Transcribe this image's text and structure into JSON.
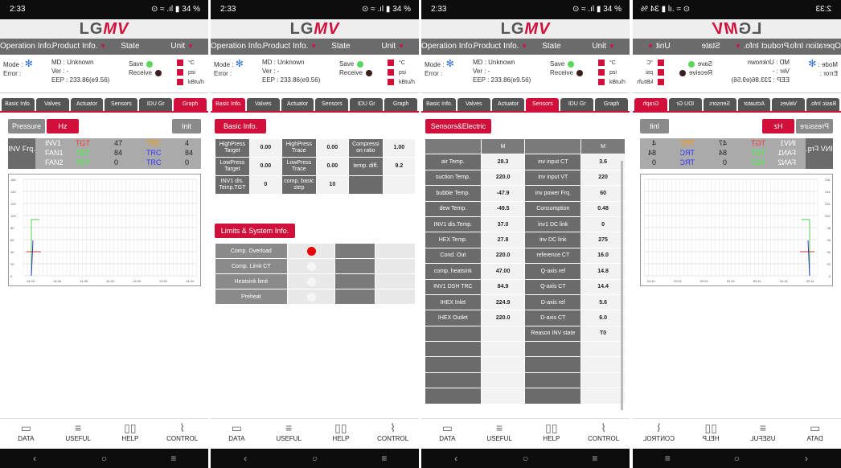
{
  "status": {
    "time": "2:33",
    "battery": "34 %"
  },
  "logo": {
    "lg": "LG",
    "mv": "MV"
  },
  "hdr": {
    "op": "Operation Info.",
    "prod": "Product Info.",
    "state": "State",
    "unit": "Unit"
  },
  "info": {
    "mode": "Mode",
    "colon": ":",
    "error": "Error :",
    "md": "MD : Unknown",
    "ver": "Ver : -",
    "eep": "EEP : 233.86(e9.56)",
    "save": "Save",
    "receive": "Receive",
    "c": "°C",
    "psi": "psi",
    "kbtuh": "kBtu/h"
  },
  "tabs": [
    "Basic Info.",
    "Valves",
    "Actuator",
    "Sensors",
    "IDU Gr",
    "Graph"
  ],
  "p1": {
    "pressure": "Pressure",
    "hz": "Hz",
    "init": "Init",
    "freq_label": "INV Frq.",
    "rows": [
      {
        "n": "INV1",
        "tgt": "TGT",
        "v1": "47",
        "trc": "TRC",
        "v2": "4"
      },
      {
        "n": "FAN1",
        "tgt": "TGT",
        "v1": "84",
        "trc": "TRC",
        "v2": "84"
      },
      {
        "n": "FAN2",
        "tgt": "TGT",
        "v1": "0",
        "trc": "TRC",
        "v2": "0"
      }
    ],
    "yticks": [
      "160",
      "140",
      "120",
      "100",
      "80",
      "60",
      "40",
      "20",
      "0"
    ],
    "xticks": [
      "14:33",
      "14:34",
      "14:36",
      "14:33",
      "13:30",
      "13:32",
      "14:34"
    ]
  },
  "p2": {
    "title": "Basic Info.",
    "g": [
      [
        "HighPress Target",
        "0.00",
        "HighPress Trace",
        "0.00",
        "Compressi on ratio",
        "1.00"
      ],
      [
        "LowPress Target",
        "0.00",
        "LowPress Trace",
        "0.00",
        "temp. diff.",
        "9.2"
      ],
      [
        "INV1 dis. Temp.TGT",
        "0",
        "comp. basic step",
        "10",
        "",
        ""
      ]
    ],
    "lim_title": "Limits & System Info.",
    "lim": [
      "Comp. Overload",
      "Comp. Limit CT",
      "Heatsink limit",
      "Preheat"
    ]
  },
  "p3": {
    "title": "Sensors&Electric",
    "m": "M",
    "rows": [
      [
        "air Temp.",
        "28.3",
        "inv input CT",
        "3.6"
      ],
      [
        "suction Temp.",
        "220.0",
        "inv input VT",
        "220"
      ],
      [
        "bubble Temp.",
        "-47.9",
        "inv power Frq.",
        "60"
      ],
      [
        "dew Temp.",
        "-49.5",
        "Consumption",
        "0.48"
      ],
      [
        "INV1 dis.Temp.",
        "37.0",
        "inv1 DC link",
        "0"
      ],
      [
        "HEX Temp.",
        "27.8",
        "inv DC link",
        "275"
      ],
      [
        "Cond. Out",
        "220.0",
        "reference CT",
        "16.0"
      ],
      [
        "comp. heatsink",
        "47.00",
        "Q-axis ref",
        "14.8"
      ],
      [
        "INV1 DSH TRC",
        "84.9",
        "Q-axis CT",
        "14.4"
      ],
      [
        "IHEX Inlet",
        "224.9",
        "D-axis ref",
        "5.6"
      ],
      [
        "IHEX Outlet",
        "220.0",
        "D-axis CT",
        "6.0"
      ],
      [
        "",
        "",
        "Reason INV state",
        "T0"
      ]
    ]
  },
  "nav": {
    "data": "DATA",
    "useful": "USEFUL",
    "help": "HELP",
    "control": "CONTROL"
  },
  "colors": {
    "accent": "#d0103a",
    "bar": "#6b6b6b"
  }
}
